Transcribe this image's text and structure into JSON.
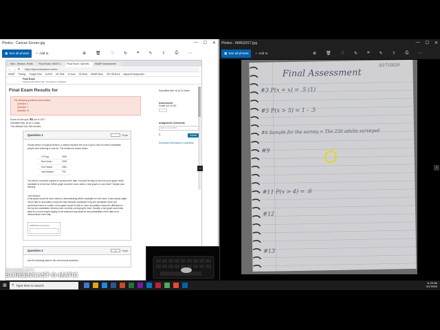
{
  "left_window": {
    "title": "Photos - Canvas Screen.jpg",
    "see_all": "See all photos",
    "add_to": "Add to"
  },
  "browser": {
    "tabs": [
      "Mail - Weston, Robin",
      "Final Exam: MATH 1",
      "Final Exam: Specific",
      "MAMP Assessment"
    ],
    "url": "https://stjmc.instructure.com/co...",
    "bookmarks": [
      "MAMP",
      "Printing",
      "Google Drive",
      "ALEKS",
      "MY Stuff",
      "10 book",
      "SS Book",
      "MAMP Book",
      "SSV SB Book",
      "Adjust All Assignment"
    ],
    "course_crumb": "Final Exam",
    "course_sub": "Fall Semester MATH 126 - Introduction to Statistics"
  },
  "quiz": {
    "page_title": "Final Exam Results for",
    "alert_title": "The following questions need review",
    "alert_items": [
      "Question 1",
      "Question 7",
      "Question 11"
    ],
    "score_label": "Score for this quiz:",
    "score_value": "81",
    "score_suffix": "out of 100 *",
    "submitted": "Submitted Mar 16 at 11:44am",
    "attempt": "This attempt took 166 minutes.",
    "q1_title": "Question 1",
    "q1_pts": "/ 5 pts",
    "q1_text": "Shortly before a mayoral election, a market research firm took a poll to find out which candidates people were planning to vote for. The results are shown below.",
    "q1_table": [
      [
        "Li Fong",
        "1520"
      ],
      [
        "Bob Green",
        "2230"
      ],
      [
        "Sue Hearst",
        "3361"
      ],
      [
        "Jose Alvarez",
        "793"
      ]
    ],
    "q1_prompt": "You wish to construct a graph to represent the data. It should be easy to see from your graph which candidate is in the lead. Which graph would be more useful, a bar graph or a pie chart? Explain your thinking.",
    "answer_label": "Your Answer:",
    "answer_text": "A bar graph would be more useful to demonstrating which candidate is in the lead. It also clearly might not be able to accurately convey the lead because candidate Fong and candidate Green are somewhat closer in number. A bar graph would be able to more accurately convey the difference in the top two candidates, thereby more correctly conveying the lead. Visually, a bar graph would also allow for a more simple display of the data and may allow for less possibilities of the data to be misconstrued more fully.",
    "additional_comments": "Additional Comments:",
    "q2_title": "Question 2",
    "q2_pts": "/ 5 pts",
    "q2_text": "Use the following data for the next several questions:"
  },
  "side": {
    "submitted_label": "Submitted Mar 16 at 11:44am",
    "assessment": "Assessment",
    "grade_out_of": "Grade out of 100",
    "assignment_comments": "Assignment Comments",
    "add_comment": "Add a Comment",
    "submit": "Submit",
    "download": "Download Submission Comments"
  },
  "right_window": {
    "title": "Photos - IMAG0217.jpg",
    "see_all": "See all photos",
    "add_to": "Add to"
  },
  "handwriting": {
    "title": "Final Assessment",
    "date": "3/17/2020",
    "q3": "#3 P(x = x) = .5 (1)",
    "q5": "#5 P(x > 5) = 1 - .5",
    "q6": "#6 Sample for the survey = The 250 adults surveyed",
    "q9": "#9",
    "q11": "#11 P(x > 4) = .6",
    "q12": "#12",
    "q13": "#13"
  },
  "watermark": {
    "line1": "RECORDED WITH",
    "line2": "SCREENCAST-O-MATIC"
  },
  "taskbar": {
    "search_placeholder": "Type here to search",
    "time": "11:25 AM",
    "date": "3/17/2020"
  }
}
